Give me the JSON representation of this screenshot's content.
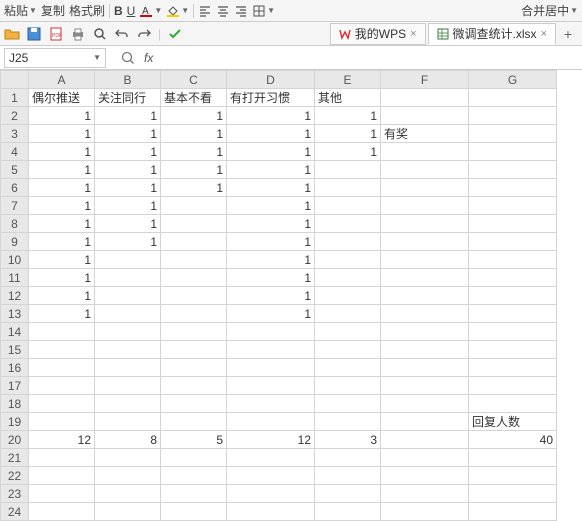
{
  "toolbar_partial": {
    "paste_suffix": "粘贴",
    "copy": "复制",
    "format_painter": "格式刷",
    "merge_center_suffix": "合并居中"
  },
  "tabs": {
    "wps_home": "我的WPS",
    "file_name": "微调查统计.xlsx"
  },
  "formula_bar": {
    "name_box": "J25",
    "fx": "fx"
  },
  "columns": [
    "A",
    "B",
    "C",
    "D",
    "E",
    "F",
    "G"
  ],
  "rows_count": 24,
  "headers": {
    "A": "偶尔推送",
    "B": "关注同行",
    "C": "基本不看",
    "D": "有打开习惯",
    "E": "其他"
  },
  "data": {
    "2": {
      "A": "1",
      "B": "1",
      "C": "1",
      "D": "1",
      "E": "1"
    },
    "3": {
      "A": "1",
      "B": "1",
      "C": "1",
      "D": "1",
      "E": "1",
      "F": "有奖"
    },
    "4": {
      "A": "1",
      "B": "1",
      "C": "1",
      "D": "1",
      "E": "1"
    },
    "5": {
      "A": "1",
      "B": "1",
      "C": "1",
      "D": "1"
    },
    "6": {
      "A": "1",
      "B": "1",
      "C": "1",
      "D": "1"
    },
    "7": {
      "A": "1",
      "B": "1",
      "D": "1"
    },
    "8": {
      "A": "1",
      "B": "1",
      "D": "1"
    },
    "9": {
      "A": "1",
      "B": "1",
      "D": "1"
    },
    "10": {
      "A": "1",
      "D": "1"
    },
    "11": {
      "A": "1",
      "D": "1"
    },
    "12": {
      "A": "1",
      "D": "1"
    },
    "13": {
      "A": "1",
      "D": "1"
    },
    "19": {
      "G": "回复人数"
    },
    "20": {
      "A": "12",
      "B": "8",
      "C": "5",
      "D": "12",
      "E": "3",
      "G": "40"
    }
  },
  "left_align_cells": [
    "1:A",
    "1:B",
    "1:C",
    "1:D",
    "1:E",
    "3:F",
    "19:G"
  ]
}
